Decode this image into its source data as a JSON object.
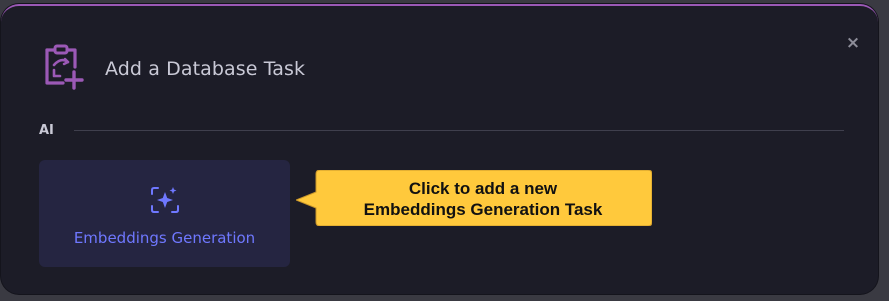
{
  "dialog": {
    "title": "Add a Database Task",
    "close_label": "×"
  },
  "section": {
    "label": "AI"
  },
  "tasks": [
    {
      "label": "Embeddings Generation",
      "icon": "sparkle-frame-icon"
    }
  ],
  "callout": {
    "line1": "Click to add a new",
    "line2": "Embeddings Generation Task",
    "color": "#ffc93c"
  },
  "colors": {
    "accent": "#9b59b6",
    "card_text": "#6f78ff",
    "background": "#1c1c27"
  }
}
